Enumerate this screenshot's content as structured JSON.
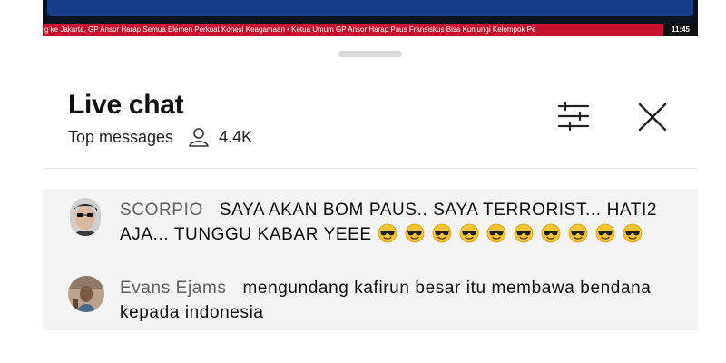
{
  "video": {
    "ticker_text": "g ke Jakarta, GP Ansor Harap Semua Elemen Perkuat Kohesi Keagamaan  •  Ketua Umum GP Ansor Harap Paus Fransiskus Bisa Kunjungi Kelompok Pe",
    "ticker_time": "11:45",
    "colors": {
      "ticker": "#c8102e",
      "banner": "#163d8a"
    }
  },
  "chat": {
    "title": "Live chat",
    "mode": "Top messages",
    "viewers": "4.4K",
    "icons": {
      "filter": "tune-icon",
      "close": "close-icon",
      "viewers": "person-icon"
    },
    "messages": [
      {
        "author": "SCORPIO",
        "text": "SAYA AKAN BOM PAUS.. SAYA TERRORIST... HATI2 AJA... TUNGGU KABAR YEEE",
        "emoji": "😎",
        "emoji_count": 10
      },
      {
        "author": "Evans Ejams",
        "text": "mengundang kafirun besar itu membawa bendana kepada indonesia"
      }
    ]
  }
}
